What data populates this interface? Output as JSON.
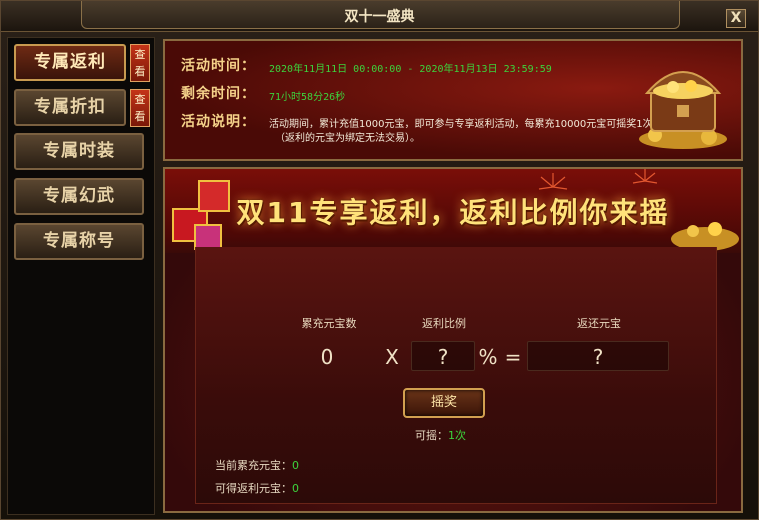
{
  "window": {
    "title": "双十一盛典",
    "close_label": "X"
  },
  "sidebar": {
    "items": [
      {
        "label": "专属返利",
        "peek_label": "查看",
        "active": true
      },
      {
        "label": "专属折扣",
        "peek_label": "查看",
        "active": false
      },
      {
        "label": "专属时装",
        "active": false
      },
      {
        "label": "专属幻武",
        "active": false
      },
      {
        "label": "专属称号",
        "active": false
      }
    ]
  },
  "info": {
    "time_label": "活动时间：",
    "time_value": "2020年11月11日 00:00:00 - 2020年11月13日 23:59:59",
    "remaining_label": "剩余时间：",
    "remaining_value": "71小时58分26秒",
    "desc_label": "活动说明：",
    "desc_line1": "活动期间，累计充值1000元宝，即可参与专享返利活动，每累充10000元宝可摇奖1次",
    "desc_line2": "（返利的元宝为绑定无法交易）。"
  },
  "main": {
    "banner_title": "双11专享返利，返利比例你来摇",
    "col_recharge": "累充元宝数",
    "col_ratio": "返利比例",
    "col_return": "返还元宝",
    "recharge_value": "0",
    "multiply_sign": "X",
    "ratio_value": "?",
    "percent_sign": "%",
    "equals_sign": "=",
    "return_value": "?",
    "shake_button": "摇奖",
    "can_shake_label": "可摇：",
    "can_shake_value": "1次",
    "current_recharge_label": "当前累充元宝：",
    "current_recharge_value": "0",
    "obtainable_label": "可得返利元宝：",
    "obtainable_value": "0"
  },
  "colors": {
    "accent_gold": "#f5d28a",
    "value_green": "#3cd33c",
    "banner_yellow": "#ffe27a",
    "frame_red": "#6a1810"
  }
}
